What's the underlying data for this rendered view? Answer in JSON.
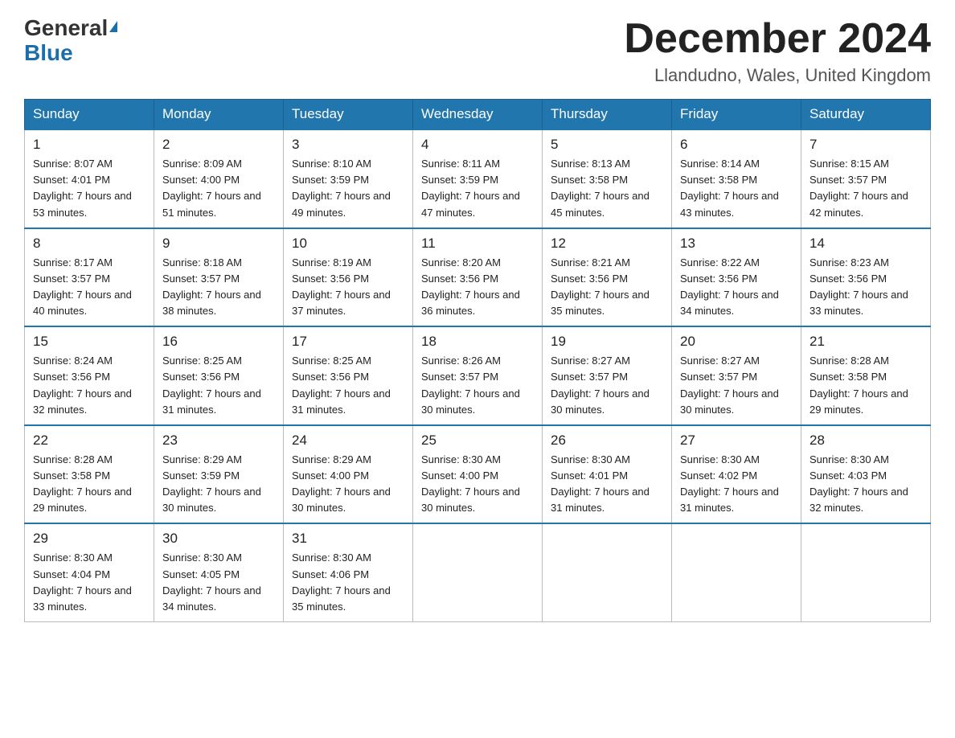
{
  "header": {
    "logo_general": "General",
    "logo_blue": "Blue",
    "month_title": "December 2024",
    "location": "Llandudno, Wales, United Kingdom"
  },
  "weekdays": [
    "Sunday",
    "Monday",
    "Tuesday",
    "Wednesday",
    "Thursday",
    "Friday",
    "Saturday"
  ],
  "weeks": [
    [
      {
        "day": "1",
        "sunrise": "Sunrise: 8:07 AM",
        "sunset": "Sunset: 4:01 PM",
        "daylight": "Daylight: 7 hours and 53 minutes."
      },
      {
        "day": "2",
        "sunrise": "Sunrise: 8:09 AM",
        "sunset": "Sunset: 4:00 PM",
        "daylight": "Daylight: 7 hours and 51 minutes."
      },
      {
        "day": "3",
        "sunrise": "Sunrise: 8:10 AM",
        "sunset": "Sunset: 3:59 PM",
        "daylight": "Daylight: 7 hours and 49 minutes."
      },
      {
        "day": "4",
        "sunrise": "Sunrise: 8:11 AM",
        "sunset": "Sunset: 3:59 PM",
        "daylight": "Daylight: 7 hours and 47 minutes."
      },
      {
        "day": "5",
        "sunrise": "Sunrise: 8:13 AM",
        "sunset": "Sunset: 3:58 PM",
        "daylight": "Daylight: 7 hours and 45 minutes."
      },
      {
        "day": "6",
        "sunrise": "Sunrise: 8:14 AM",
        "sunset": "Sunset: 3:58 PM",
        "daylight": "Daylight: 7 hours and 43 minutes."
      },
      {
        "day": "7",
        "sunrise": "Sunrise: 8:15 AM",
        "sunset": "Sunset: 3:57 PM",
        "daylight": "Daylight: 7 hours and 42 minutes."
      }
    ],
    [
      {
        "day": "8",
        "sunrise": "Sunrise: 8:17 AM",
        "sunset": "Sunset: 3:57 PM",
        "daylight": "Daylight: 7 hours and 40 minutes."
      },
      {
        "day": "9",
        "sunrise": "Sunrise: 8:18 AM",
        "sunset": "Sunset: 3:57 PM",
        "daylight": "Daylight: 7 hours and 38 minutes."
      },
      {
        "day": "10",
        "sunrise": "Sunrise: 8:19 AM",
        "sunset": "Sunset: 3:56 PM",
        "daylight": "Daylight: 7 hours and 37 minutes."
      },
      {
        "day": "11",
        "sunrise": "Sunrise: 8:20 AM",
        "sunset": "Sunset: 3:56 PM",
        "daylight": "Daylight: 7 hours and 36 minutes."
      },
      {
        "day": "12",
        "sunrise": "Sunrise: 8:21 AM",
        "sunset": "Sunset: 3:56 PM",
        "daylight": "Daylight: 7 hours and 35 minutes."
      },
      {
        "day": "13",
        "sunrise": "Sunrise: 8:22 AM",
        "sunset": "Sunset: 3:56 PM",
        "daylight": "Daylight: 7 hours and 34 minutes."
      },
      {
        "day": "14",
        "sunrise": "Sunrise: 8:23 AM",
        "sunset": "Sunset: 3:56 PM",
        "daylight": "Daylight: 7 hours and 33 minutes."
      }
    ],
    [
      {
        "day": "15",
        "sunrise": "Sunrise: 8:24 AM",
        "sunset": "Sunset: 3:56 PM",
        "daylight": "Daylight: 7 hours and 32 minutes."
      },
      {
        "day": "16",
        "sunrise": "Sunrise: 8:25 AM",
        "sunset": "Sunset: 3:56 PM",
        "daylight": "Daylight: 7 hours and 31 minutes."
      },
      {
        "day": "17",
        "sunrise": "Sunrise: 8:25 AM",
        "sunset": "Sunset: 3:56 PM",
        "daylight": "Daylight: 7 hours and 31 minutes."
      },
      {
        "day": "18",
        "sunrise": "Sunrise: 8:26 AM",
        "sunset": "Sunset: 3:57 PM",
        "daylight": "Daylight: 7 hours and 30 minutes."
      },
      {
        "day": "19",
        "sunrise": "Sunrise: 8:27 AM",
        "sunset": "Sunset: 3:57 PM",
        "daylight": "Daylight: 7 hours and 30 minutes."
      },
      {
        "day": "20",
        "sunrise": "Sunrise: 8:27 AM",
        "sunset": "Sunset: 3:57 PM",
        "daylight": "Daylight: 7 hours and 30 minutes."
      },
      {
        "day": "21",
        "sunrise": "Sunrise: 8:28 AM",
        "sunset": "Sunset: 3:58 PM",
        "daylight": "Daylight: 7 hours and 29 minutes."
      }
    ],
    [
      {
        "day": "22",
        "sunrise": "Sunrise: 8:28 AM",
        "sunset": "Sunset: 3:58 PM",
        "daylight": "Daylight: 7 hours and 29 minutes."
      },
      {
        "day": "23",
        "sunrise": "Sunrise: 8:29 AM",
        "sunset": "Sunset: 3:59 PM",
        "daylight": "Daylight: 7 hours and 30 minutes."
      },
      {
        "day": "24",
        "sunrise": "Sunrise: 8:29 AM",
        "sunset": "Sunset: 4:00 PM",
        "daylight": "Daylight: 7 hours and 30 minutes."
      },
      {
        "day": "25",
        "sunrise": "Sunrise: 8:30 AM",
        "sunset": "Sunset: 4:00 PM",
        "daylight": "Daylight: 7 hours and 30 minutes."
      },
      {
        "day": "26",
        "sunrise": "Sunrise: 8:30 AM",
        "sunset": "Sunset: 4:01 PM",
        "daylight": "Daylight: 7 hours and 31 minutes."
      },
      {
        "day": "27",
        "sunrise": "Sunrise: 8:30 AM",
        "sunset": "Sunset: 4:02 PM",
        "daylight": "Daylight: 7 hours and 31 minutes."
      },
      {
        "day": "28",
        "sunrise": "Sunrise: 8:30 AM",
        "sunset": "Sunset: 4:03 PM",
        "daylight": "Daylight: 7 hours and 32 minutes."
      }
    ],
    [
      {
        "day": "29",
        "sunrise": "Sunrise: 8:30 AM",
        "sunset": "Sunset: 4:04 PM",
        "daylight": "Daylight: 7 hours and 33 minutes."
      },
      {
        "day": "30",
        "sunrise": "Sunrise: 8:30 AM",
        "sunset": "Sunset: 4:05 PM",
        "daylight": "Daylight: 7 hours and 34 minutes."
      },
      {
        "day": "31",
        "sunrise": "Sunrise: 8:30 AM",
        "sunset": "Sunset: 4:06 PM",
        "daylight": "Daylight: 7 hours and 35 minutes."
      },
      null,
      null,
      null,
      null
    ]
  ]
}
